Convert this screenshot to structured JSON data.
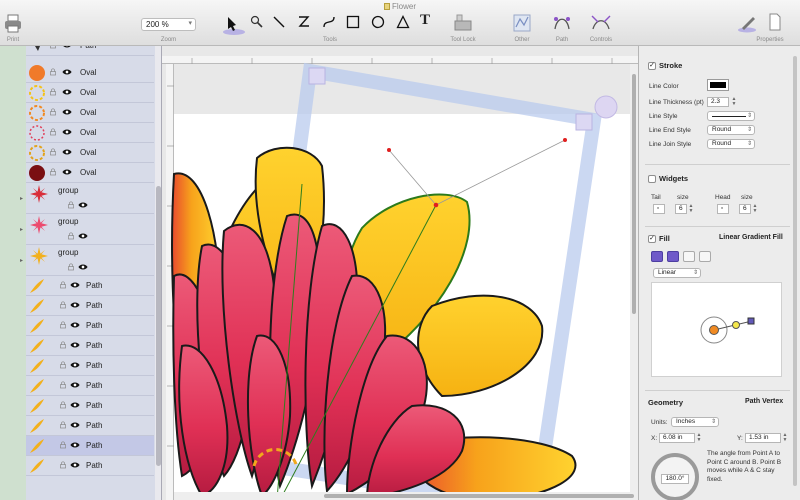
{
  "window": {
    "title": "Flower"
  },
  "toolbar": {
    "print_label": "Print",
    "zoom_value": "200 %",
    "zoom_label": "Zoom",
    "tools_label": "Tools",
    "toollock_label": "Tool Lock",
    "other_label": "Other",
    "path_label": "Path",
    "controls_label": "Controls",
    "properties_label": "Properties",
    "text_tool_glyph": "T"
  },
  "layers": [
    {
      "name": "Path",
      "kind": "path-dark"
    },
    {
      "name": "Oval",
      "kind": "oval-orange"
    },
    {
      "name": "Oval",
      "kind": "oval-dash-yellow"
    },
    {
      "name": "Oval",
      "kind": "oval-dash-orange"
    },
    {
      "name": "Oval",
      "kind": "oval-dash-red"
    },
    {
      "name": "Oval",
      "kind": "oval-dash-gold"
    },
    {
      "name": "Oval",
      "kind": "oval-darkred"
    },
    {
      "name": "group",
      "kind": "group-red"
    },
    {
      "name": "group",
      "kind": "group-pink"
    },
    {
      "name": "group",
      "kind": "group-yellow"
    },
    {
      "name": "Path",
      "kind": "petal"
    },
    {
      "name": "Path",
      "kind": "petal"
    },
    {
      "name": "Path",
      "kind": "petal"
    },
    {
      "name": "Path",
      "kind": "petal"
    },
    {
      "name": "Path",
      "kind": "petal"
    },
    {
      "name": "Path",
      "kind": "petal"
    },
    {
      "name": "Path",
      "kind": "petal"
    },
    {
      "name": "Path",
      "kind": "petal"
    },
    {
      "name": "Path",
      "kind": "petal",
      "selected": true
    },
    {
      "name": "Path",
      "kind": "petal"
    }
  ],
  "inspector": {
    "stroke": {
      "title": "Stroke",
      "checked": "✓",
      "line_color_label": "Line Color",
      "line_color": "#000000",
      "line_thickness_label": "Line Thickness (pt)",
      "line_thickness": "2.3",
      "line_style_label": "Line Style",
      "line_end_style_label": "Line End Style",
      "line_end_style": "Round",
      "line_join_style_label": "Line Join Style",
      "line_join_style": "Round"
    },
    "widgets": {
      "title": "Widgets",
      "tail_label": "Tail",
      "size_label": "size",
      "tail_size": "6",
      "head_label": "Head",
      "head_size_label": "size",
      "head_size": "6"
    },
    "fill": {
      "title": "Fill",
      "checked": "✓",
      "mode": "Linear Gradient Fill",
      "gradient_type": "Linear"
    },
    "geometry": {
      "title": "Geometry",
      "tab": "Path Vertex",
      "units_label": "Units:",
      "units": "Inches",
      "x_label": "X:",
      "x_value": "6.08 in",
      "y_label": "Y:",
      "y_value": "1.53 in",
      "angle": "180.0°",
      "help": "The angle from Point A to Point C around B.  Point B moves while A & C stay fixed."
    }
  },
  "colors": {
    "accent": "#6f59c9",
    "selection": "#c3c8e6",
    "handle": "#b8c4ec"
  }
}
